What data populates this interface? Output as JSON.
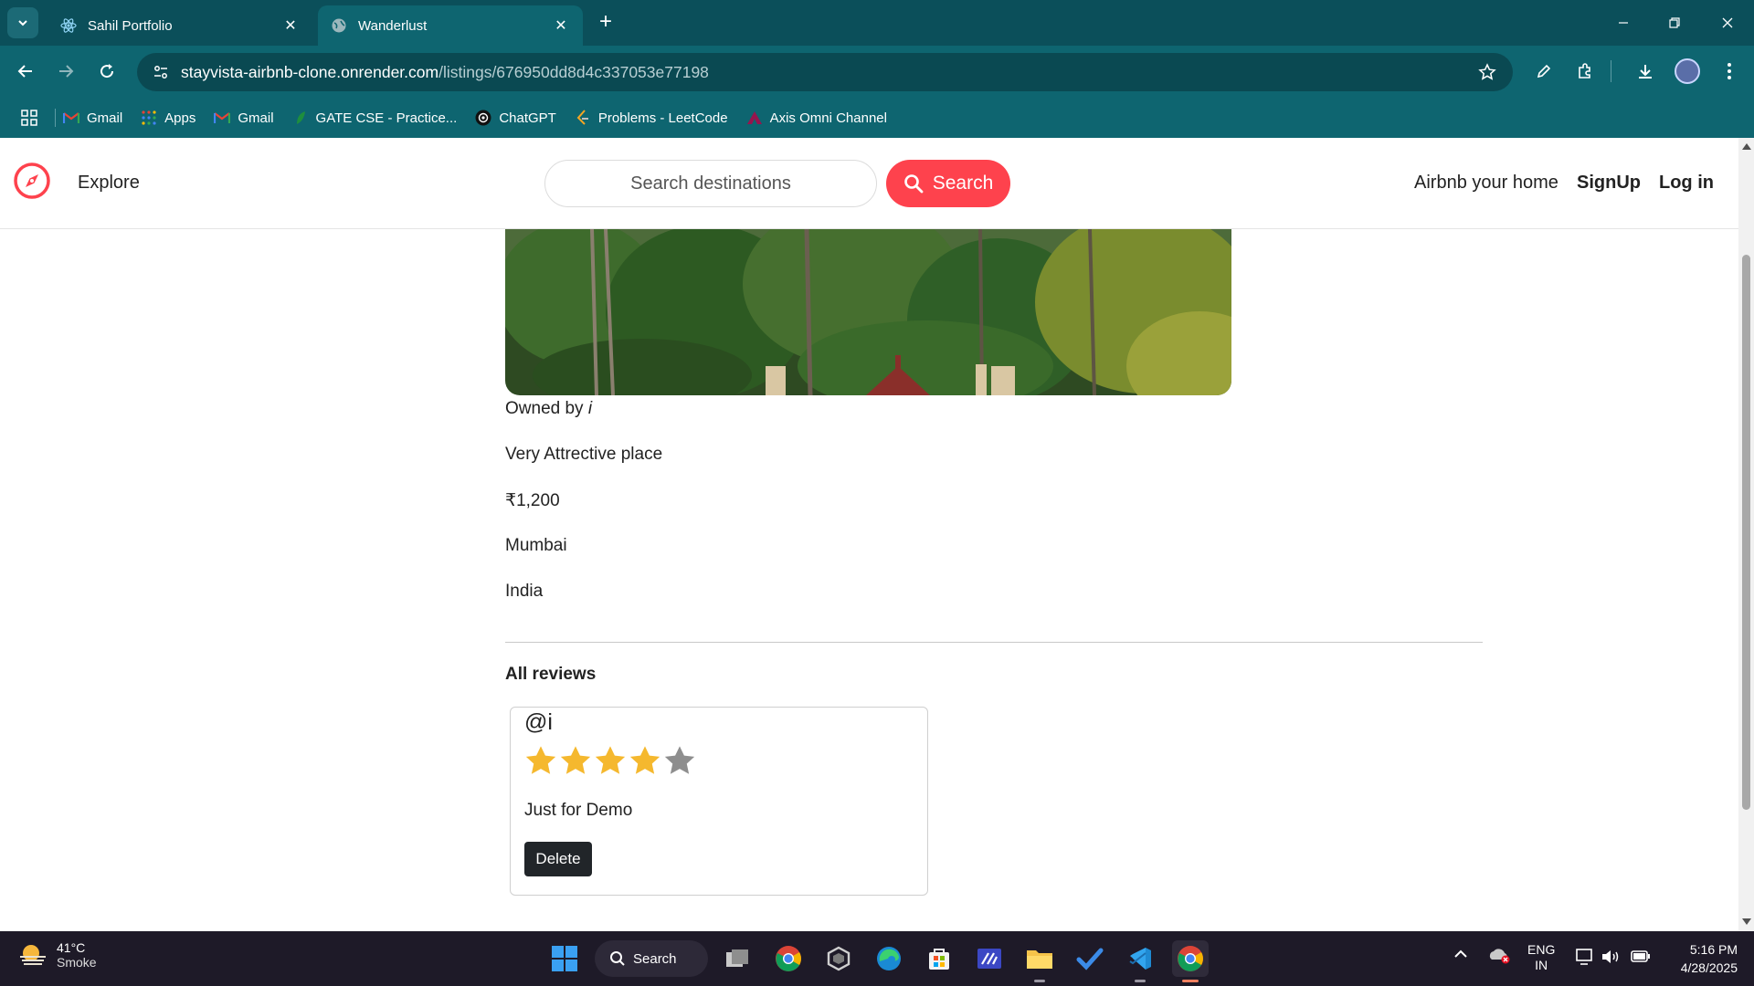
{
  "browser": {
    "tabs": [
      {
        "title": "Sahil Portfolio",
        "icon": "react-icon",
        "active": false
      },
      {
        "title": "Wanderlust",
        "icon": "globe-icon",
        "active": true
      }
    ],
    "url_host": "stayvista-airbnb-clone.onrender.com",
    "url_path": "/listings/676950dd8d4c337053e77198",
    "bookmarks": [
      {
        "label": "Gmail",
        "icon": "gmail-icon"
      },
      {
        "label": "Apps",
        "icon": "apps-grid-icon"
      },
      {
        "label": "Gmail",
        "icon": "gmail-icon"
      },
      {
        "label": "GATE CSE - Practice...",
        "icon": "leaf-icon"
      },
      {
        "label": "ChatGPT",
        "icon": "chatgpt-icon"
      },
      {
        "label": "Problems - LeetCode",
        "icon": "leetcode-icon"
      },
      {
        "label": "Axis Omni Channel",
        "icon": "axis-icon"
      }
    ]
  },
  "navbar": {
    "explore": "Explore",
    "search_placeholder": "Search destinations",
    "search_button": "Search",
    "airbnb_home": "Airbnb your home",
    "signup": "SignUp",
    "login": "Log in",
    "brand_color": "#fe424d"
  },
  "listing": {
    "owned_by_prefix": "Owned by",
    "owner": "i",
    "description": "Very Attrective place",
    "price": "₹1,200",
    "location": "Mumbai",
    "country": "India"
  },
  "reviews": {
    "heading": "All reviews",
    "items": [
      {
        "author": "@i",
        "rating": 4,
        "max_rating": 5,
        "comment": "Just for Demo",
        "delete_label": "Delete"
      }
    ]
  },
  "taskbar": {
    "weather_temp": "41°C",
    "weather_cond": "Smoke",
    "search_label": "Search",
    "lang_1": "ENG",
    "lang_2": "IN",
    "time": "5:16 PM",
    "date": "4/28/2025"
  }
}
